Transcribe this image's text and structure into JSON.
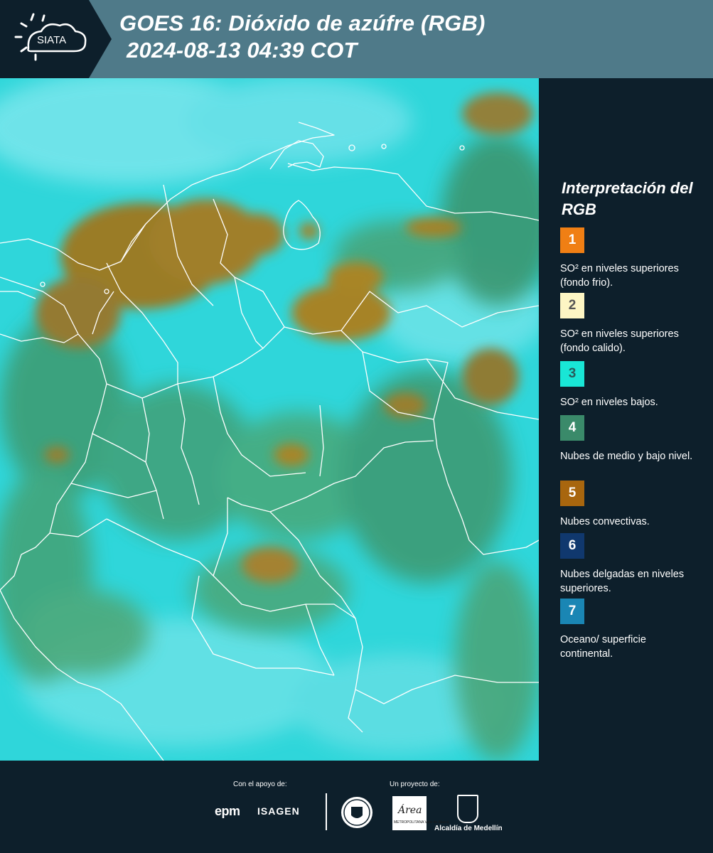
{
  "header": {
    "logo_text": "SIATA",
    "title_line1": "GOES 16: Dióxido de azúfre (RGB)",
    "title_line2": "2024-08-13 04:39 COT"
  },
  "legend": {
    "title": "Interpretación del RGB",
    "items": [
      {
        "number": "1",
        "color": "#f07f14",
        "num_color": "#ffffff",
        "text": "SO² en niveles superiores (fondo frio)."
      },
      {
        "number": "2",
        "color": "#fdf6c4",
        "num_color": "#555555",
        "text": "SO² en niveles superiores (fondo calido)."
      },
      {
        "number": "3",
        "color": "#19e6d6",
        "num_color": "#2a5a5a",
        "text": "SO² en niveles bajos."
      },
      {
        "number": "4",
        "color": "#3a8a6a",
        "num_color": "#ffffff",
        "text": "Nubes de medio y bajo nivel."
      },
      {
        "number": "5",
        "color": "#a8660e",
        "num_color": "#ffffff",
        "text": "Nubes convectivas."
      },
      {
        "number": "6",
        "color": "#10386e",
        "num_color": "#ffffff",
        "text": "Nubes delgadas en niveles superiores."
      },
      {
        "number": "7",
        "color": "#1a86b4",
        "num_color": "#ffffff",
        "text": "Oceano/ superficie continental."
      }
    ]
  },
  "footer": {
    "support_label": "Con el apoyo de:",
    "project_label": "Un proyecto de:",
    "sponsor1": "epm",
    "sponsor2": "ISAGEN",
    "area_logo_word": "Área",
    "area_logo_sub": "METROPOLITANA Valle de Aburrá",
    "alcaldia": "Alcaldía de Medellín"
  }
}
